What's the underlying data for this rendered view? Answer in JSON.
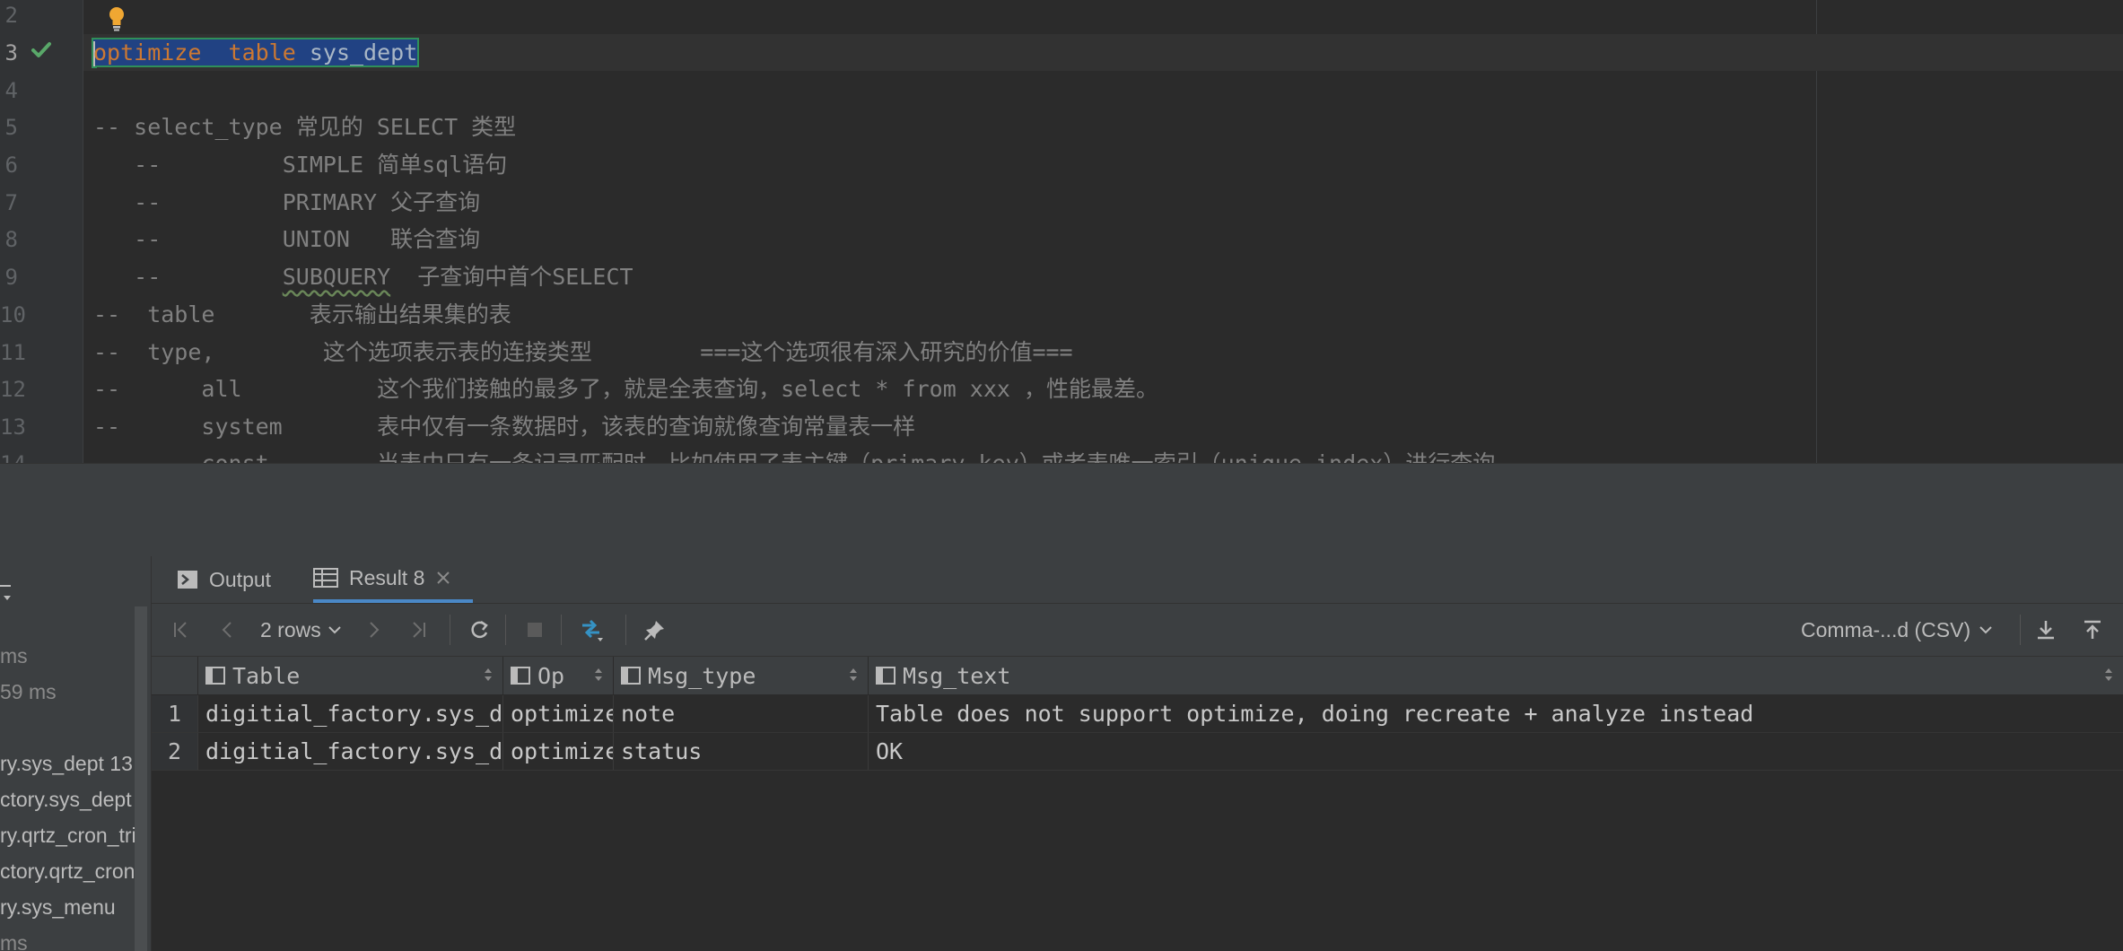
{
  "editor": {
    "lines": [
      {
        "num": "2",
        "text": ""
      },
      {
        "num": "3",
        "text": "optimize  table sys_dept"
      },
      {
        "num": "4",
        "text": ""
      },
      {
        "num": "5",
        "text": "-- select_type 常见的 SELECT 类型"
      },
      {
        "num": "6",
        "text": "   --         SIMPLE 简单sql语句"
      },
      {
        "num": "7",
        "text": "   --         PRIMARY 父子查询"
      },
      {
        "num": "8",
        "text": "   --         UNION   联合查询"
      },
      {
        "num": "9",
        "text": "   --         SUBQUERY  子查询中首个SELECT"
      },
      {
        "num": "10",
        "text": "--  table       表示输出结果集的表"
      },
      {
        "num": "11",
        "text": "--  type,        这个选项表示表的连接类型        ===这个选项很有深入研究的价值==="
      },
      {
        "num": "12",
        "text": "--      all          这个我们接触的最多了，就是全表查询，select * from xxx ，性能最差。"
      },
      {
        "num": "13",
        "text": "--      system       表中仅有一条数据时，该表的查询就像查询常量表一样"
      },
      {
        "num": "14",
        "text": "--      const        当表中只有一条记录匹配时，比如使用了表主键（primary key）或者表唯一索引（unique index）进行查询"
      }
    ],
    "line3_parts": {
      "kw1": "optimize",
      "gap": "  ",
      "kw2": "table",
      "ident": " sys_dept"
    },
    "line9_parts": {
      "prefix": "   --         ",
      "squiggle": "SUBQUERY",
      "suffix": "  子查询中首个SELECT"
    }
  },
  "left_panel": {
    "items": [
      {
        "text": "ms",
        "dim": true
      },
      {
        "text": "59 ms",
        "dim": true
      },
      {
        "text": "ry.sys_dept  13",
        "dim": false
      },
      {
        "text": "ctory.sys_dept",
        "dim": false
      },
      {
        "text": "ry.qrtz_cron_tri",
        "dim": false
      },
      {
        "text": "ctory.qrtz_cron_",
        "dim": false
      },
      {
        "text": "ry.sys_menu",
        "dim": false
      },
      {
        "text": "ms",
        "dim": true
      }
    ]
  },
  "tabs": [
    {
      "label": "Output"
    },
    {
      "label": "Result 8"
    }
  ],
  "toolbar": {
    "rows_label": "2 rows",
    "format_label": "Comma-...d (CSV)"
  },
  "grid": {
    "columns": [
      "Table",
      "Op",
      "Msg_type",
      "Msg_text"
    ],
    "rows": [
      {
        "num": "1",
        "cells": [
          "digitial_factory.sys_dept",
          "optimize",
          "note",
          "Table does not support optimize, doing recreate + analyze instead"
        ]
      },
      {
        "num": "2",
        "cells": [
          "digitial_factory.sys_dept",
          "optimize",
          "status",
          "OK"
        ]
      }
    ]
  },
  "colors": {
    "accent": "#4a88c7",
    "keyword": "#cc7832",
    "comment": "#808080",
    "success": "#59a869"
  }
}
